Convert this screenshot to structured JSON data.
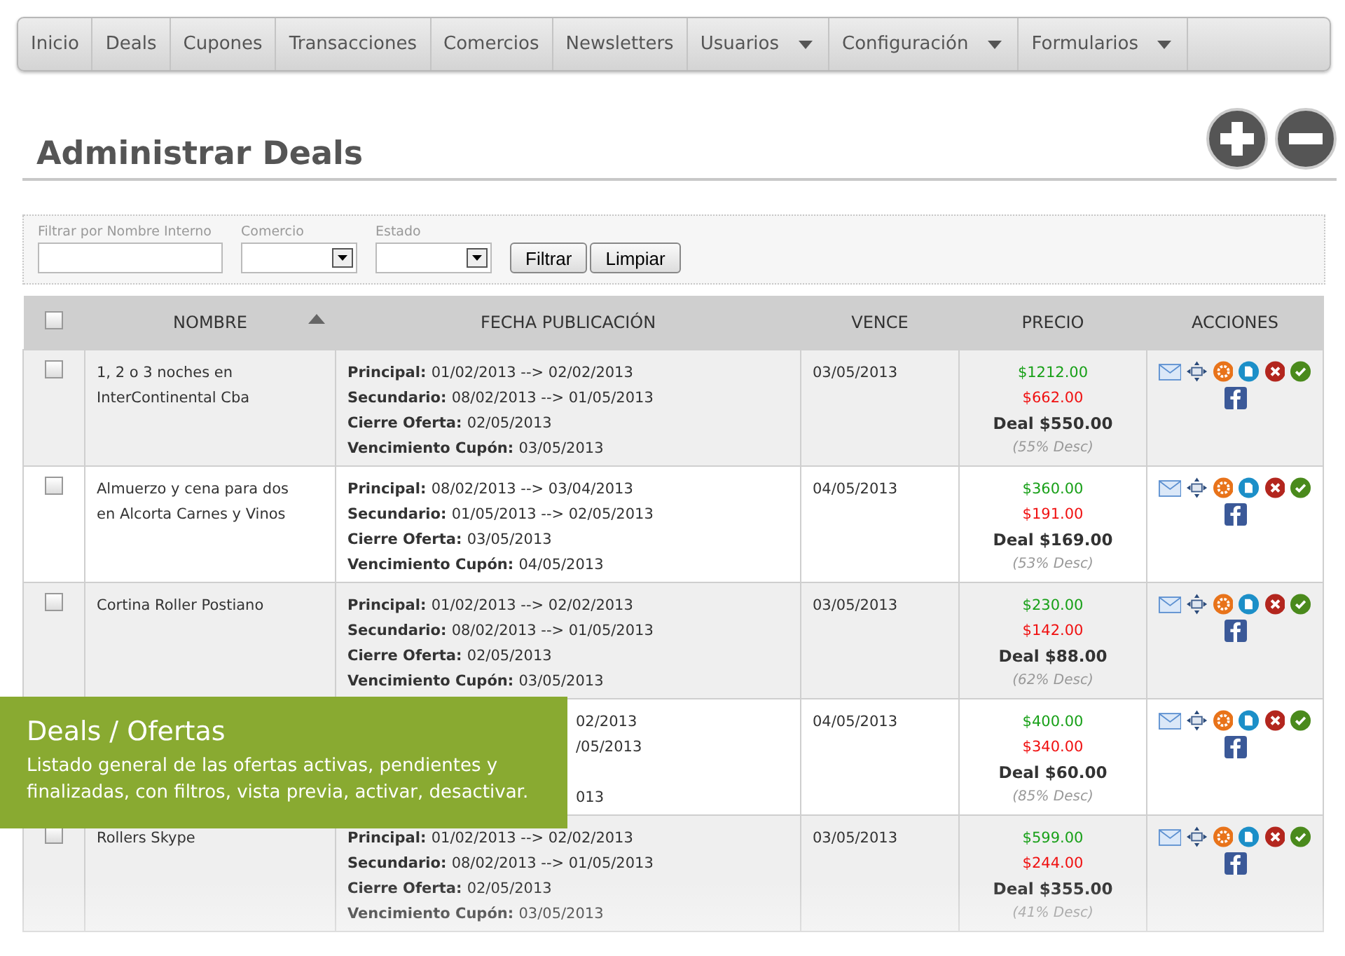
{
  "nav": [
    {
      "label": "Inicio",
      "dropdown": false
    },
    {
      "label": "Deals",
      "dropdown": false
    },
    {
      "label": "Cupones",
      "dropdown": false
    },
    {
      "label": "Transacciones",
      "dropdown": false
    },
    {
      "label": "Comercios",
      "dropdown": false
    },
    {
      "label": "Newsletters",
      "dropdown": false
    },
    {
      "label": "Usuarios",
      "dropdown": true
    },
    {
      "label": "Configuración",
      "dropdown": true
    },
    {
      "label": "Formularios",
      "dropdown": true
    }
  ],
  "title": "Administrar Deals",
  "filters": {
    "name_label": "Filtrar por Nombre Interno",
    "comercio_label": "Comercio",
    "estado_label": "Estado",
    "buttons": [
      "Filtrar",
      "Limpiar"
    ]
  },
  "table": {
    "select_all_checked": false,
    "columns": [
      "NOMBRE",
      "FECHA PUBLICACIÓN",
      "VENCE",
      "PRECIO",
      "ACCIONES"
    ],
    "rows": [
      {
        "kind": "full",
        "checked": false,
        "name": "1, 2 o 3 noches en InterContinental Cba",
        "dates": [
          {
            "label": "Principal:",
            "value": "01/02/2013 --> 02/02/2013"
          },
          {
            "label": "Secundario:",
            "value": "08/02/2013 --> 01/05/2013"
          },
          {
            "label": "Cierre Oferta:",
            "value": "02/05/2013"
          },
          {
            "label": "Vencimiento Cupón:",
            "value": "03/05/2013"
          }
        ],
        "vence": "03/05/2013",
        "list_price": "$1212.00",
        "discount_amount": "$662.00",
        "deal_price": "Deal $550.00",
        "discount": "(55% Desc)"
      },
      {
        "kind": "full",
        "checked": false,
        "name": "Almuerzo y cena para dos en Alcorta Carnes y Vinos",
        "dates": [
          {
            "label": "Principal:",
            "value": "08/02/2013 --> 03/04/2013"
          },
          {
            "label": "Secundario:",
            "value": "01/05/2013 --> 02/05/2013"
          },
          {
            "label": "Cierre Oferta:",
            "value": "03/05/2013"
          },
          {
            "label": "Vencimiento Cupón:",
            "value": "04/05/2013"
          }
        ],
        "vence": "04/05/2013",
        "list_price": "$360.00",
        "discount_amount": "$191.00",
        "deal_price": "Deal $169.00",
        "discount": "(53% Desc)"
      },
      {
        "kind": "full",
        "checked": false,
        "name": "Cortina Roller Postiano",
        "dates": [
          {
            "label": "Principal:",
            "value": "01/02/2013 --> 02/02/2013"
          },
          {
            "label": "Secundario:",
            "value": "08/02/2013 --> 01/05/2013"
          },
          {
            "label": "Cierre Oferta:",
            "value": "02/05/2013"
          },
          {
            "label": "Vencimiento Cupón:",
            "value": "03/05/2013"
          }
        ],
        "vence": "03/05/2013",
        "list_price": "$230.00",
        "discount_amount": "$142.00",
        "deal_price": "Deal $88.00",
        "discount": "(62% Desc)"
      },
      {
        "kind": "covered",
        "dates": [
          {
            "value": "02/2013"
          },
          {
            "value": "/05/2013"
          },
          {
            "value": "013"
          }
        ],
        "vence": "04/05/2013",
        "list_price": "$400.00",
        "discount_amount": "$340.00",
        "deal_price": "Deal $60.00",
        "discount": "(85% Desc)"
      },
      {
        "kind": "full",
        "checked": false,
        "name": "Rollers Skype",
        "dates": [
          {
            "label": "Principal:",
            "value": "01/02/2013 --> 02/02/2013"
          },
          {
            "label": "Secundario:",
            "value": "08/02/2013 --> 01/05/2013"
          },
          {
            "label": "Cierre Oferta:",
            "value": "02/05/2013"
          },
          {
            "label": "Vencimiento Cupón:",
            "value": "03/05/2013"
          }
        ],
        "vence": "03/05/2013",
        "list_price": "$599.00",
        "discount_amount": "$244.00",
        "deal_price": "Deal $355.00",
        "discount": "(41% Desc)"
      }
    ]
  },
  "banner": {
    "title": "Deals / Ofertas",
    "text": "Listado general de las ofertas activas, pendientes y finalizadas, con filtros, vista previa, activar, desactivar."
  }
}
